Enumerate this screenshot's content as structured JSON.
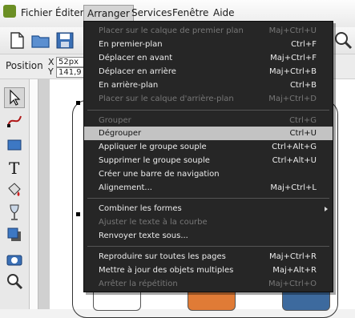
{
  "menubar": {
    "items": [
      "Fichier",
      "Éditer",
      "Arranger",
      "Services",
      "Fenêtre",
      "Aide"
    ]
  },
  "position_bar": {
    "label": "Position",
    "x_label": "X",
    "y_label": "Y",
    "x_value": "52px",
    "y_value": "141,9"
  },
  "menu": {
    "items": [
      {
        "label": "Placer sur le calque de premier plan",
        "shortcut": "Maj+Ctrl+U",
        "enabled": false
      },
      {
        "label": "En premier-plan",
        "shortcut": "Ctrl+F",
        "enabled": true
      },
      {
        "label": "Déplacer en avant",
        "shortcut": "Maj+Ctrl+F",
        "enabled": true
      },
      {
        "label": "Déplacer en arrière",
        "shortcut": "Maj+Ctrl+B",
        "enabled": true
      },
      {
        "label": "En arrière-plan",
        "shortcut": "Ctrl+B",
        "enabled": true
      },
      {
        "label": "Placer sur le calque d'arrière-plan",
        "shortcut": "Maj+Ctrl+D",
        "enabled": false
      },
      {
        "label": "Grouper",
        "shortcut": "Ctrl+G",
        "enabled": false
      },
      {
        "label": "Dégrouper",
        "shortcut": "Ctrl+U",
        "enabled": true,
        "highlighted": true
      },
      {
        "label": "Appliquer le groupe souple",
        "shortcut": "Ctrl+Alt+G",
        "enabled": true
      },
      {
        "label": "Supprimer le groupe souple",
        "shortcut": "Ctrl+Alt+U",
        "enabled": true
      },
      {
        "label": "Créer une barre de navigation",
        "shortcut": "",
        "enabled": true
      },
      {
        "label": "Alignement...",
        "shortcut": "Maj+Ctrl+L",
        "enabled": true
      },
      {
        "label": "Combiner les formes",
        "shortcut": "",
        "enabled": true,
        "submenu": true
      },
      {
        "label": "Ajuster le texte à la courbe",
        "shortcut": "",
        "enabled": false
      },
      {
        "label": "Renvoyer texte sous...",
        "shortcut": "",
        "enabled": true
      },
      {
        "label": "Reproduire sur toutes les pages",
        "shortcut": "Maj+Ctrl+R",
        "enabled": true
      },
      {
        "label": "Mettre à jour des objets multiples",
        "shortcut": "Maj+Alt+R",
        "enabled": true
      },
      {
        "label": "Arrêter la répétition",
        "shortcut": "Maj+Ctrl+O",
        "enabled": false
      }
    ]
  },
  "icons": {
    "new_doc": "new-document-icon",
    "open": "open-folder-icon",
    "save": "save-icon",
    "zoom": "zoom-icon",
    "select": "selector-arrow-icon",
    "shape_edit": "shape-edit-icon",
    "rectangle": "rectangle-icon",
    "text": "text-icon",
    "fill": "fill-bucket-icon",
    "transparency": "transparency-glass-icon",
    "shadow": "shadow-icon",
    "photo": "camera-icon",
    "zoom_tool": "zoom-tool-icon"
  },
  "colors": {
    "menu_bg": "#262626",
    "highlight": "#c3c3c3",
    "disabled_text": "#777777"
  }
}
